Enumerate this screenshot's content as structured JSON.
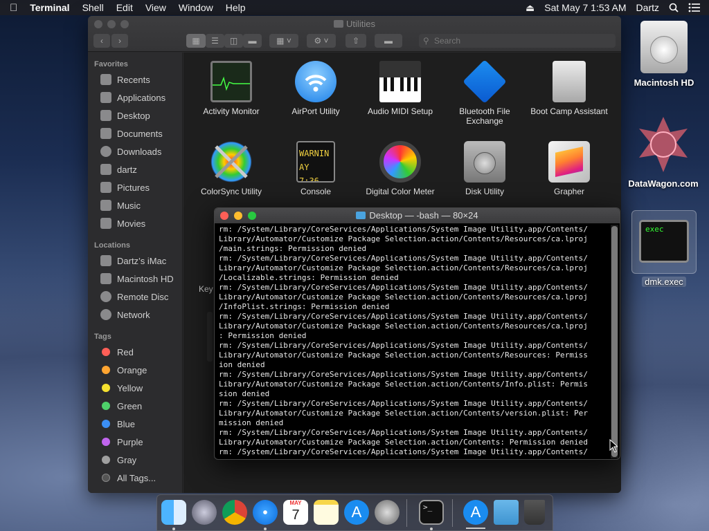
{
  "menubar": {
    "app": "Terminal",
    "items": [
      "Shell",
      "Edit",
      "View",
      "Window",
      "Help"
    ],
    "datetime": "Sat May 7  1:53 AM",
    "user": "Dartz"
  },
  "finder": {
    "title": "Utilities",
    "search_placeholder": "Search",
    "sidebar": {
      "favorites_header": "Favorites",
      "favorites": [
        "Recents",
        "Applications",
        "Desktop",
        "Documents",
        "Downloads",
        "dartz",
        "Pictures",
        "Music",
        "Movies"
      ],
      "locations_header": "Locations",
      "locations": [
        "Dartz’s iMac",
        "Macintosh HD",
        "Remote Disc",
        "Network"
      ],
      "tags_header": "Tags",
      "tags": [
        {
          "label": "Red",
          "color": "#ff5f57"
        },
        {
          "label": "Orange",
          "color": "#ffa531"
        },
        {
          "label": "Yellow",
          "color": "#f5e12f"
        },
        {
          "label": "Green",
          "color": "#4ed06a"
        },
        {
          "label": "Blue",
          "color": "#3b8ff5"
        },
        {
          "label": "Purple",
          "color": "#c165ee"
        },
        {
          "label": "Gray",
          "color": "#a0a0a0"
        },
        {
          "label": "All Tags...",
          "color": "#555555"
        }
      ]
    },
    "apps": [
      {
        "label": "Activity Monitor",
        "icon": "activity-monitor-icon"
      },
      {
        "label": "AirPort Utility",
        "icon": "airport-utility-icon"
      },
      {
        "label": "Audio MIDI Setup",
        "icon": "audio-midi-icon"
      },
      {
        "label": "Bluetooth File Exchange",
        "icon": "bluetooth-icon"
      },
      {
        "label": "Boot Camp Assistant",
        "icon": "boot-camp-icon"
      },
      {
        "label": "ColorSync Utility",
        "icon": "colorsync-icon"
      },
      {
        "label": "Console",
        "icon": "console-icon"
      },
      {
        "label": "Digital Color Meter",
        "icon": "digital-color-meter-icon"
      },
      {
        "label": "Disk Utility",
        "icon": "disk-utility-icon"
      },
      {
        "label": "Grapher",
        "icon": "grapher-icon"
      }
    ],
    "console_icon_text": [
      "WARNIN",
      "AY 7:36"
    ],
    "partial_label": "Key"
  },
  "terminal": {
    "title": "Desktop — -bash — 80×24",
    "lines": [
      "rm: /System/Library/CoreServices/Applications/System Image Utility.app/Contents/",
      "Library/Automator/Customize Package Selection.action/Contents/Resources/ca.lproj",
      "/main.strings: Permission denied",
      "rm: /System/Library/CoreServices/Applications/System Image Utility.app/Contents/",
      "Library/Automator/Customize Package Selection.action/Contents/Resources/ca.lproj",
      "/Localizable.strings: Permission denied",
      "rm: /System/Library/CoreServices/Applications/System Image Utility.app/Contents/",
      "Library/Automator/Customize Package Selection.action/Contents/Resources/ca.lproj",
      "/InfoPlist.strings: Permission denied",
      "rm: /System/Library/CoreServices/Applications/System Image Utility.app/Contents/",
      "Library/Automator/Customize Package Selection.action/Contents/Resources/ca.lproj",
      ": Permission denied",
      "rm: /System/Library/CoreServices/Applications/System Image Utility.app/Contents/",
      "Library/Automator/Customize Package Selection.action/Contents/Resources: Permiss",
      "ion denied",
      "rm: /System/Library/CoreServices/Applications/System Image Utility.app/Contents/",
      "Library/Automator/Customize Package Selection.action/Contents/Info.plist: Permis",
      "sion denied",
      "rm: /System/Library/CoreServices/Applications/System Image Utility.app/Contents/",
      "Library/Automator/Customize Package Selection.action/Contents/version.plist: Per",
      "mission denied",
      "rm: /System/Library/CoreServices/Applications/System Image Utility.app/Contents/",
      "Library/Automator/Customize Package Selection.action/Contents: Permission denied",
      "rm: /System/Library/CoreServices/Applications/System Image Utility.app/Contents/"
    ]
  },
  "desktop": {
    "icons": [
      {
        "label": "Macintosh HD",
        "icon": "hard-drive-icon"
      },
      {
        "label": "DataWagon.com",
        "icon": "datawagon-icon"
      },
      {
        "label": "dmk.exec",
        "icon": "exec-file-icon",
        "inner_text": "exec"
      }
    ]
  },
  "dock": {
    "items": [
      "Finder",
      "Launchpad",
      "Chrome",
      "Safari",
      "Calendar",
      "Notes",
      "App Store",
      "System Preferences",
      "Terminal",
      "Applications",
      "Downloads",
      "Trash"
    ],
    "calendar_month": "MAY",
    "calendar_day": "7"
  }
}
